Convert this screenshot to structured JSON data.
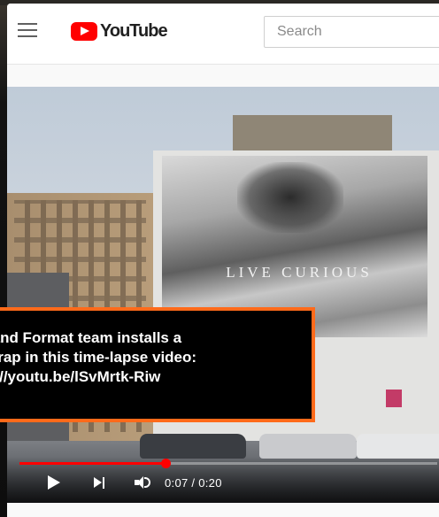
{
  "header": {
    "logo_text": "YouTube",
    "search_placeholder": "Search"
  },
  "video": {
    "banner_text": "LIVE CURIOUS",
    "progress_fraction": 0.35,
    "time_display": "0:07 / 0:20"
  },
  "caption": {
    "lines": [
      "rand Format team installs a",
      "wrap in this time-lapse video:",
      "s://youtu.be/lSvMrtk-Riw"
    ]
  },
  "colors": {
    "accent": "#ff0000",
    "caption_border": "#ff6a1a"
  },
  "icons": {
    "menu": "hamburger-menu-icon",
    "logo": "youtube-logo-icon",
    "play": "play-icon",
    "next": "next-icon",
    "volume": "volume-icon"
  }
}
